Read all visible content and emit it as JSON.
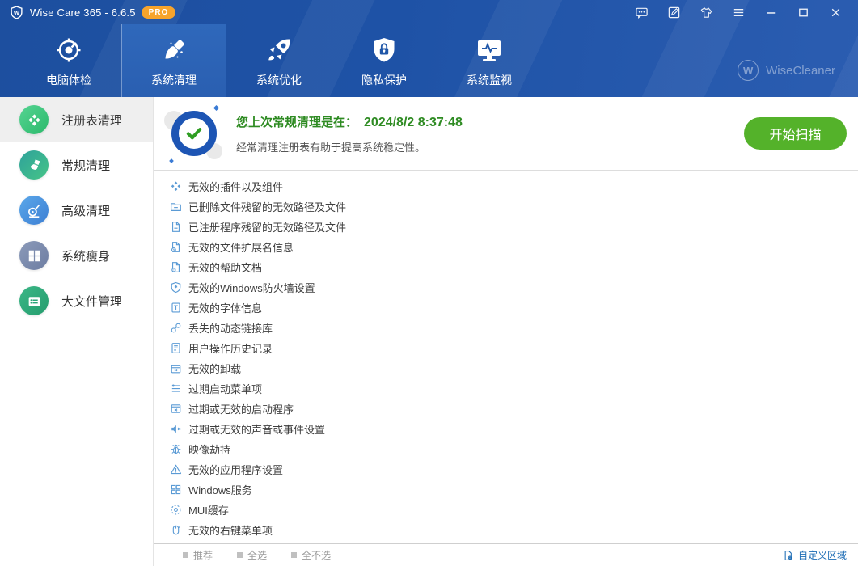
{
  "window": {
    "title": "Wise Care 365 - 6.6.5",
    "badge": "PRO"
  },
  "titlebar": {
    "buttons": [
      {
        "name": "feedback-icon"
      },
      {
        "name": "edit-icon"
      },
      {
        "name": "theme-icon"
      },
      {
        "name": "menu-icon"
      },
      {
        "name": "minimize-icon"
      },
      {
        "name": "maximize-icon"
      },
      {
        "name": "close-icon"
      }
    ]
  },
  "nav": {
    "brand": "WiseCleaner",
    "tabs": [
      {
        "id": "pc-checkup",
        "label": "电脑体检",
        "icon": "pc-checkup-icon",
        "active": false
      },
      {
        "id": "system-clean",
        "label": "系统清理",
        "icon": "clean-icon",
        "active": true
      },
      {
        "id": "system-optimize",
        "label": "系统优化",
        "icon": "optimize-icon",
        "active": false
      },
      {
        "id": "privacy-protect",
        "label": "隐私保护",
        "icon": "privacy-icon",
        "active": false
      },
      {
        "id": "system-monitor",
        "label": "系统监视",
        "icon": "monitor-icon",
        "active": false
      }
    ]
  },
  "sidebar": {
    "items": [
      {
        "id": "registry-clean",
        "label": "注册表清理",
        "icon": "registry-icon",
        "color_from": "#55d492",
        "color_to": "#2cb96b",
        "active": true
      },
      {
        "id": "common-clean",
        "label": "常规清理",
        "icon": "brush-icon",
        "color_from": "#2fa29b",
        "color_to": "#45c487",
        "active": false
      },
      {
        "id": "advanced-clean",
        "label": "高级清理",
        "icon": "vacuum-icon",
        "color_from": "#5ba8ea",
        "color_to": "#3d7fd3",
        "active": false
      },
      {
        "id": "system-slim",
        "label": "系统瘦身",
        "icon": "grid-icon",
        "color_from": "#8b9ab9",
        "color_to": "#6d7da2",
        "active": false
      },
      {
        "id": "big-file-manager",
        "label": "大文件管理",
        "icon": "bigfile-icon",
        "color_from": "#3bb787",
        "color_to": "#259c6d",
        "active": false
      }
    ]
  },
  "header": {
    "status_title": "您上次常规清理是在：",
    "status_time": "2024/8/2 8:37:48",
    "status_desc": "经常清理注册表有助于提高系统稳定性。",
    "scan_button": "开始扫描"
  },
  "list": {
    "items": [
      {
        "icon": "plugin-icon",
        "label": "无效的插件以及组件"
      },
      {
        "icon": "folder-del-icon",
        "label": "已删除文件残留的无效路径及文件"
      },
      {
        "icon": "file-del-icon",
        "label": "已注册程序残留的无效路径及文件"
      },
      {
        "icon": "file-ext-icon",
        "label": "无效的文件扩展名信息"
      },
      {
        "icon": "help-doc-icon",
        "label": "无效的帮助文档"
      },
      {
        "icon": "firewall-icon",
        "label": "无效的Windows防火墙设置"
      },
      {
        "icon": "font-icon",
        "label": "无效的字体信息"
      },
      {
        "icon": "dll-icon",
        "label": "丢失的动态链接库"
      },
      {
        "icon": "history-icon",
        "label": "用户操作历史记录"
      },
      {
        "icon": "uninstall-icon",
        "label": "无效的卸载"
      },
      {
        "icon": "startmenu-icon",
        "label": "过期启动菜单项"
      },
      {
        "icon": "startup-icon",
        "label": "过期或无效的启动程序"
      },
      {
        "icon": "sound-icon",
        "label": "过期或无效的声音或事件设置"
      },
      {
        "icon": "bug-icon",
        "label": "映像劫持"
      },
      {
        "icon": "appsettings-icon",
        "label": "无效的应用程序设置"
      },
      {
        "icon": "services-icon",
        "label": "Windows服务"
      },
      {
        "icon": "mui-icon",
        "label": "MUI缓存"
      },
      {
        "icon": "contextmenu-icon",
        "label": "无效的右键菜单项"
      }
    ]
  },
  "footer": {
    "links": [
      {
        "id": "recommend",
        "label": "推荐"
      },
      {
        "id": "select-all",
        "label": "全选"
      },
      {
        "id": "select-none",
        "label": "全不选"
      }
    ],
    "custom_area": "自定义区域"
  },
  "colors": {
    "chrome_blue": "#1e52a6",
    "nav_active_blue": "#2b62b5",
    "button_green": "#54b22a",
    "status_green": "#2e8b22",
    "badge_orange": "#f7a42c",
    "list_icon_blue": "#5b9bd5",
    "link_blue": "#1c6cb5",
    "ring_blue": "#1d55b4"
  }
}
